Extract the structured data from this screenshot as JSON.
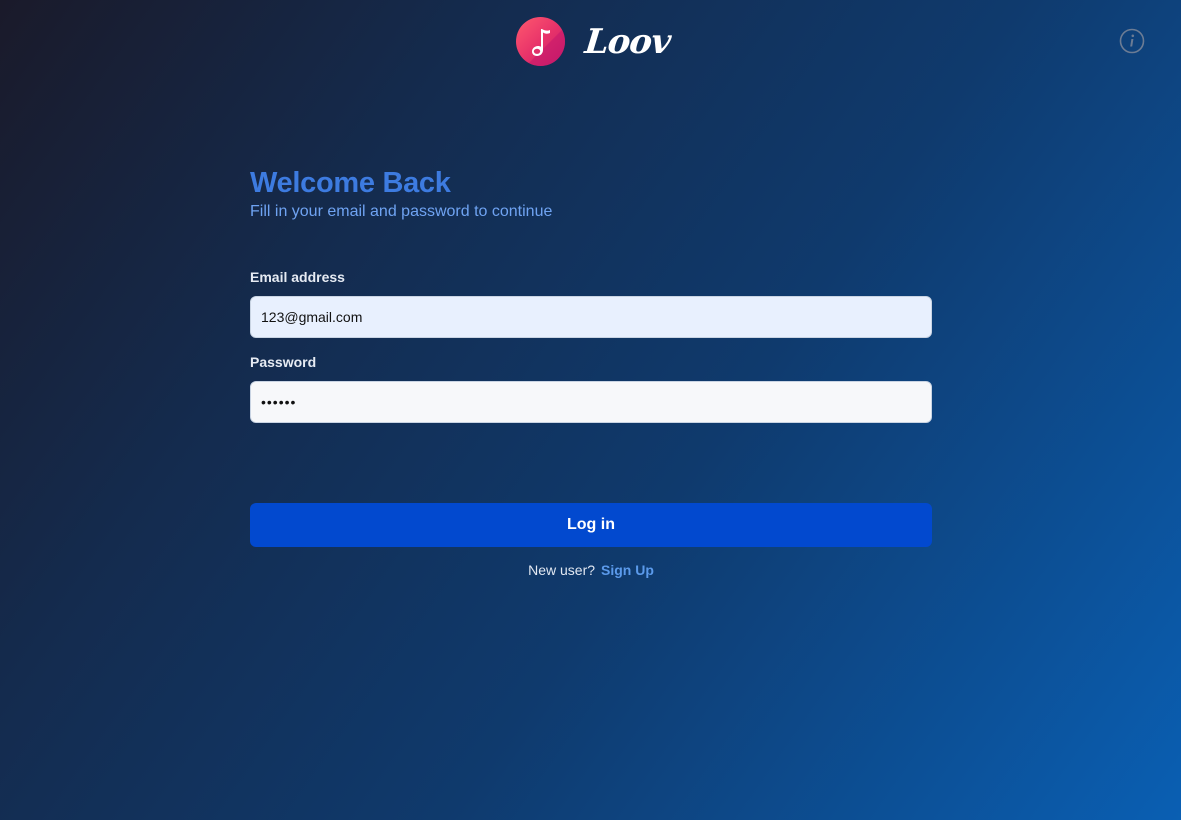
{
  "app": {
    "name": "Loov",
    "logo_icon": "music-note-icon",
    "info_icon": "info-icon"
  },
  "login": {
    "title": "Welcome Back",
    "subtitle": "Fill in your email and password to continue",
    "email_label": "Email address",
    "email_value": "123@gmail.com",
    "password_label": "Password",
    "password_value": "••••••",
    "submit_label": "Log in",
    "signup_prompt": "New user?",
    "signup_link": "Sign Up"
  },
  "colors": {
    "accent": "#3d7be0",
    "button": "#0249cf",
    "link": "#5b9aeb",
    "logo_gradient_start": "#ff5a6e",
    "logo_gradient_end": "#c2186b"
  }
}
